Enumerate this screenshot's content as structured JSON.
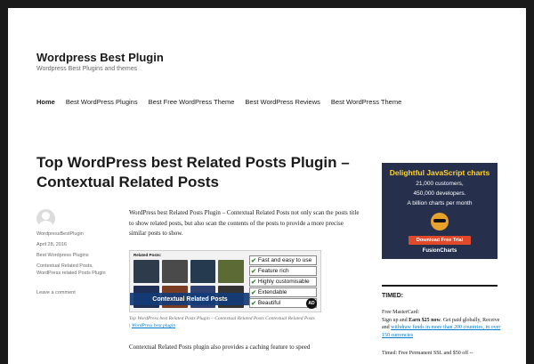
{
  "site": {
    "title": "Wordpress Best Plugin",
    "description": "Wordpress Best Plugins and themes"
  },
  "nav": {
    "items": [
      {
        "label": "Home"
      },
      {
        "label": "Best WordPress Plugins"
      },
      {
        "label": "Best Free WordPress Theme"
      },
      {
        "label": "Best WordPress Reviews"
      },
      {
        "label": "Best WordPress Theme"
      }
    ]
  },
  "post": {
    "title": "Top WordPress best Related Posts Plugin – Contextual Related Posts",
    "author": "WordpressBestPlugin",
    "date": "April 28, 2016",
    "category": "Best Wordpress Plugins",
    "tags": "Contextual Related Posts, WordPress related Posts Plugin",
    "comment_link": "Leave a comment",
    "paragraph1": "WordPress best Related Posts Plugin – Contextual Related Posts not only scan the posts title to show related posts, but also scan the contents of the posts to provide a more precise similar posts to show.",
    "paragraph2": "Contextual Related Posts plugin also provides a caching feature to speed",
    "caption_text": "Top WordPress best Related Posts Plugin – Contextual Related Posts Contextual Related Posts |",
    "caption_link": "WordPress best plugin"
  },
  "figure": {
    "header": "Related Posts:",
    "banner": "Contextual Related Posts",
    "features": [
      "Fast and easy to use",
      "Feature rich",
      "Highly customisable",
      "Extendable",
      "Beautiful"
    ],
    "badge": "AD"
  },
  "sidebar_ad": {
    "headline": "Delightful JavaScript charts",
    "customers": "21,000 customers,",
    "developers": "450,000 developers.",
    "views": "A billion charts per month",
    "cta": "Download Free Trial",
    "brand": "FusionCharts"
  },
  "widget": {
    "title": "TIMED:",
    "line1_a": "Free MasterCard:",
    "line1_b": "Sign up and ",
    "line1_bold": "Earn $25 now",
    "line1_c": ". Get paid globally, Receive and ",
    "line1_link": "withdraw funds in more than 200 countries, in over 150 currencies",
    "line2_a": "Timed: ",
    "line2_b": "Free Permanent SSL and $50 off --"
  },
  "colors": {
    "frame": "#1a1a1a",
    "link": "#007acc",
    "text": "#1a1a1a",
    "meta": "#686868"
  }
}
